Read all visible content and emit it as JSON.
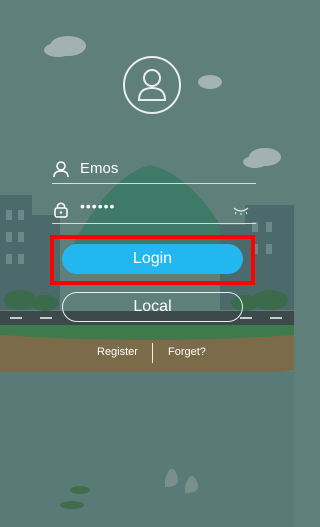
{
  "login_form": {
    "username_value": "Emos",
    "password_value": "••••••",
    "login_label": "Login",
    "local_label": "Local",
    "register_label": "Register",
    "forget_label": "Forget?"
  },
  "icons": {
    "avatar": "user-avatar-icon",
    "username": "person-icon",
    "password": "lock-icon",
    "visibility": "eye-closed-icon"
  },
  "colors": {
    "primary_button": "#22b7ee",
    "highlight_box": "#ff0000",
    "background": "#5f7f7a"
  }
}
